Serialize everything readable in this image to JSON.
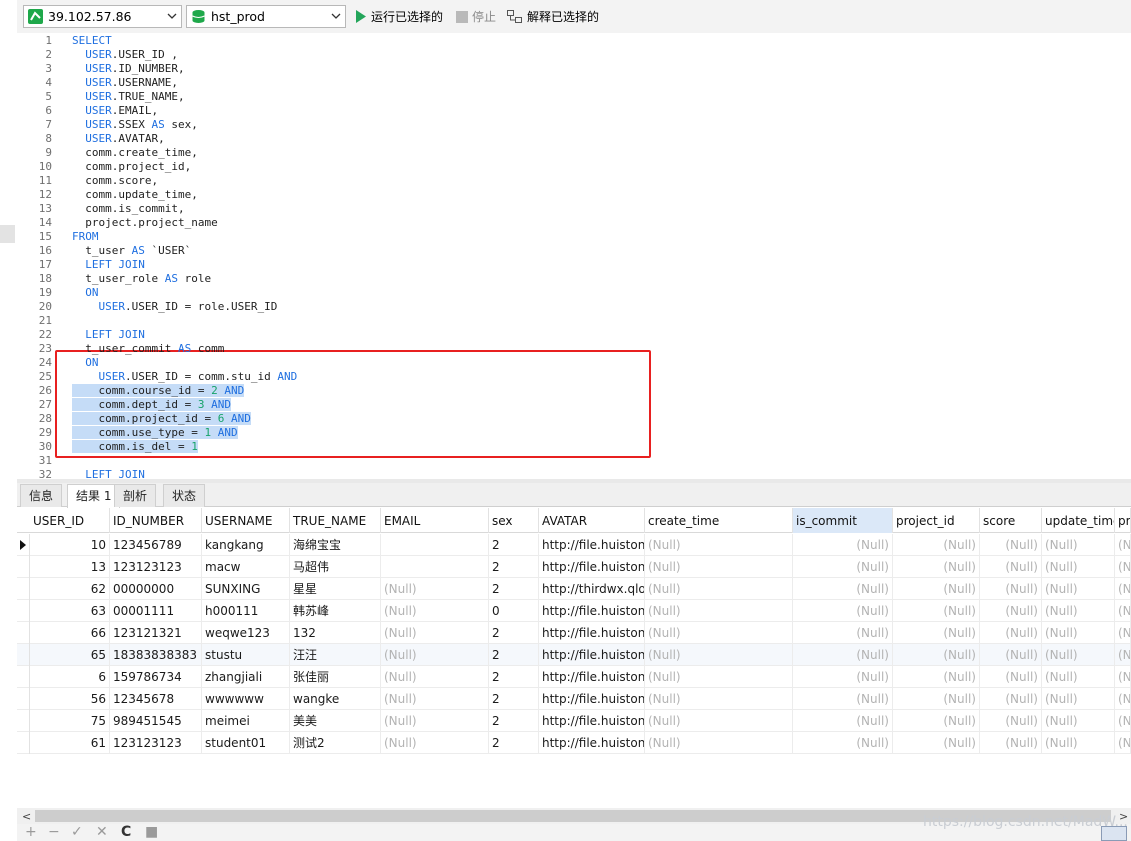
{
  "toolbar": {
    "connection": "39.102.57.86",
    "database": "hst_prod",
    "run_selected": "运行已选择的",
    "stop": "停止",
    "explain_selected": "解释已选择的"
  },
  "editor": {
    "lines": [
      {
        "n": "1",
        "t": "SELECT"
      },
      {
        "n": "2",
        "t": "  USER.USER_ID ,"
      },
      {
        "n": "3",
        "t": "  USER.ID_NUMBER,"
      },
      {
        "n": "4",
        "t": "  USER.USERNAME,"
      },
      {
        "n": "5",
        "t": "  USER.TRUE_NAME,"
      },
      {
        "n": "6",
        "t": "  USER.EMAIL,"
      },
      {
        "n": "7",
        "t": "  USER.SSEX AS sex,"
      },
      {
        "n": "8",
        "t": "  USER.AVATAR,"
      },
      {
        "n": "9",
        "t": "  comm.create_time,"
      },
      {
        "n": "10",
        "t": "  comm.project_id,"
      },
      {
        "n": "11",
        "t": "  comm.score,"
      },
      {
        "n": "12",
        "t": "  comm.update_time,"
      },
      {
        "n": "13",
        "t": "  comm.is_commit,"
      },
      {
        "n": "14",
        "t": "  project.project_name"
      },
      {
        "n": "15",
        "t": "FROM"
      },
      {
        "n": "16",
        "t": "  t_user AS `USER`"
      },
      {
        "n": "17",
        "t": "  LEFT JOIN"
      },
      {
        "n": "18",
        "t": "  t_user_role AS role"
      },
      {
        "n": "19",
        "t": "  ON"
      },
      {
        "n": "20",
        "t": "    USER.USER_ID = role.USER_ID"
      },
      {
        "n": "21",
        "t": ""
      },
      {
        "n": "22",
        "t": "  LEFT JOIN"
      },
      {
        "n": "23",
        "t": "  t_user_commit AS comm"
      },
      {
        "n": "24",
        "t": "  ON"
      },
      {
        "n": "25",
        "t": "    USER.USER_ID = comm.stu_id AND"
      },
      {
        "n": "26",
        "t": "    comm.course_id = 2 AND"
      },
      {
        "n": "27",
        "t": "    comm.dept_id = 3 AND"
      },
      {
        "n": "28",
        "t": "    comm.project_id = 6 AND"
      },
      {
        "n": "29",
        "t": "    comm.use_type = 1 AND"
      },
      {
        "n": "30",
        "t": "    comm.is_del = 1"
      },
      {
        "n": "31",
        "t": ""
      },
      {
        "n": "32",
        "t": "  LEFT JOIN"
      }
    ]
  },
  "tabs": [
    "信息",
    "结果 1",
    "剖析",
    "状态"
  ],
  "grid": {
    "columns": [
      "USER_ID",
      "ID_NUMBER",
      "USERNAME",
      "TRUE_NAME",
      "EMAIL",
      "sex",
      "AVATAR",
      "create_time",
      "is_commit",
      "project_id",
      "score",
      "update_time",
      "pr"
    ],
    "rows": [
      [
        "10",
        "123456789",
        "kangkang",
        "海绵宝宝",
        "",
        "2",
        "http://file.huistone",
        "(Null)",
        "(Null)",
        "(Null)",
        "(Null)",
        "(Null)",
        "(N"
      ],
      [
        "13",
        "123123123",
        "macw",
        "马超伟",
        "",
        "2",
        "http://file.huistone",
        "(Null)",
        "(Null)",
        "(Null)",
        "(Null)",
        "(Null)",
        "(N"
      ],
      [
        "62",
        "00000000",
        "SUNXING",
        "星星",
        "(Null)",
        "2",
        "http://thirdwx.qlog",
        "(Null)",
        "(Null)",
        "(Null)",
        "(Null)",
        "(Null)",
        "(N"
      ],
      [
        "63",
        "00001111",
        "h000111",
        "韩苏峰",
        "(Null)",
        "0",
        "http://file.huistone",
        "(Null)",
        "(Null)",
        "(Null)",
        "(Null)",
        "(Null)",
        "(N"
      ],
      [
        "66",
        "123121321",
        "weqwe123",
        "132",
        "(Null)",
        "2",
        "http://file.huistone",
        "(Null)",
        "(Null)",
        "(Null)",
        "(Null)",
        "(Null)",
        "(N"
      ],
      [
        "65",
        "18383838383",
        "stustu",
        "汪汪",
        "(Null)",
        "2",
        "http://file.huistone",
        "(Null)",
        "(Null)",
        "(Null)",
        "(Null)",
        "(Null)",
        "(N"
      ],
      [
        "6",
        "159786734",
        "zhangjiali",
        "张佳丽",
        "(Null)",
        "2",
        "http://file.huistone",
        "(Null)",
        "(Null)",
        "(Null)",
        "(Null)",
        "(Null)",
        "(N"
      ],
      [
        "56",
        "12345678",
        "wwwwww",
        "wangke",
        "(Null)",
        "2",
        "http://file.huistone",
        "(Null)",
        "(Null)",
        "(Null)",
        "(Null)",
        "(Null)",
        "(N"
      ],
      [
        "75",
        "989451545",
        "meimei",
        "美美",
        "(Null)",
        "2",
        "http://file.huistone",
        "(Null)",
        "(Null)",
        "(Null)",
        "(Null)",
        "(Null)",
        "(N"
      ],
      [
        "61",
        "123123123",
        "student01",
        "测试2",
        "(Null)",
        "2",
        "http://file.huistone",
        "(Null)",
        "(Null)",
        "(Null)",
        "(Null)",
        "(Null)",
        "(N"
      ]
    ]
  },
  "bottombar": {
    "buttons": [
      "+",
      "−",
      "✓",
      "✕",
      "C",
      "■"
    ],
    "watermark": "https://blog.csdn.net/MadW..."
  },
  "colors": {
    "keyword": "#1f6fe0",
    "number": "#17a36a",
    "selection": "#c5dcf7",
    "highlight_box": "#e82020",
    "null_text": "#b3b3b3"
  }
}
